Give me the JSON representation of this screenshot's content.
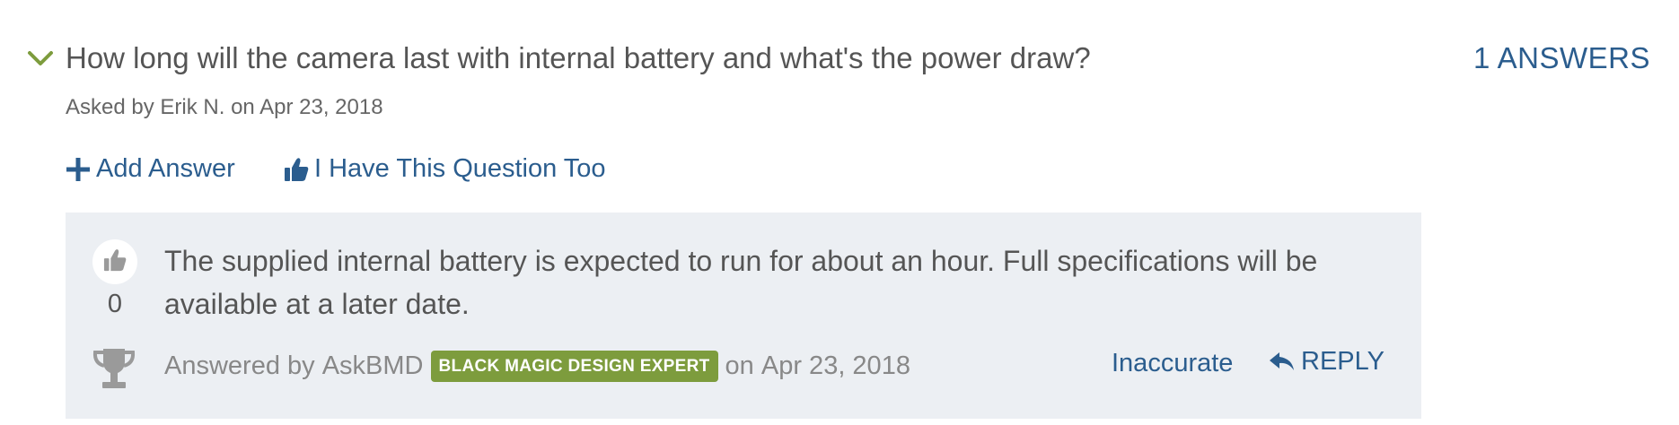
{
  "question": {
    "text": "How long will the camera last with internal battery and what's the power draw?",
    "answers_count_label": "1 ANSWERS",
    "asked_prefix": "Asked by",
    "asked_by": "Erik N.",
    "asked_on_prefix": "on",
    "asked_date": "Apr 23, 2018",
    "expand_icon": "chevron-down-icon"
  },
  "actions": {
    "add_answer_label": "Add Answer",
    "add_answer_icon": "plus-icon",
    "have_question_label": "I Have This Question Too",
    "have_question_icon": "thumbs-up-icon"
  },
  "answer": {
    "votes": "0",
    "text": "The supplied internal battery is expected to run for about an hour. Full specifications will be available at a later date.",
    "answered_prefix": "Answered by",
    "answered_by": "AskBMD",
    "badge": "BLACK MAGIC DESIGN EXPERT",
    "answered_on_prefix": "on",
    "answered_date": "Apr 23, 2018",
    "inaccurate_label": "Inaccurate",
    "reply_label": "REPLY",
    "reply_icon": "reply-arrow-icon",
    "trophy_icon": "trophy-icon"
  },
  "colors": {
    "link": "#2b5d8e",
    "accent_green": "#7d9c3d",
    "answer_bg": "#eceff3",
    "text": "#555555"
  }
}
